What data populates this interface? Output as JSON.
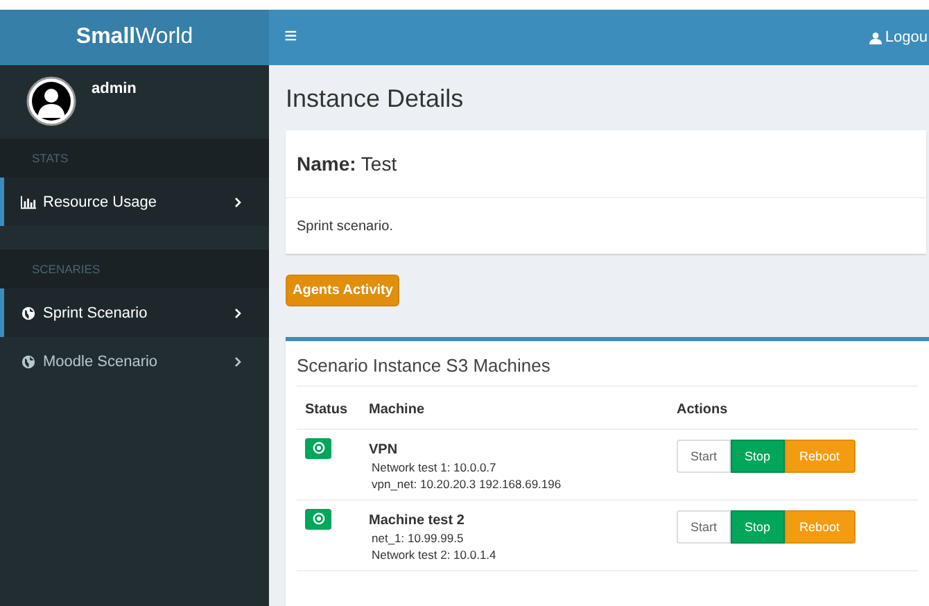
{
  "logo": "**Small**World",
  "navbar": {
    "menu_glyph": "≡",
    "logout": "Logou"
  },
  "user": {
    "name": "admin"
  },
  "sidebar": [
    {
      "header": "STATS",
      "items": [
        {
          "label": "Resource Usage",
          "kind": "chart",
          "selected": true
        }
      ]
    },
    {
      "header": "SCENARIES",
      "items": [
        {
          "label": "Sprint Scenario",
          "kind": "globe",
          "selected": true
        },
        {
          "label": "Moodle Scenario",
          "kind": "globe",
          "selected": false
        }
      ]
    }
  ],
  "page_title": "Instance Details",
  "instance": {
    "name": "**Name:** Test",
    "description": "Sprint scenario."
  },
  "agents_button": "Agents Activity",
  "machines": {
    "title": "Scenario Instance S3 Machines",
    "columns": [
      "Status",
      "Machine",
      "Actions"
    ],
    "rows": [
      {
        "on": true,
        "name": "VPN",
        "networks": [
          "Network test 1: 10.0.0.7",
          "vpn_net: 10.20.20.3  192.168.69.196"
        ],
        "actions": [
          "Start",
          "Stop",
          "Reboot"
        ]
      },
      {
        "on": true,
        "name": "Machine test 2",
        "networks": [
          "net_1: 10.99.99.5",
          "Network test 2: 10.0.1.4"
        ],
        "actions": [
          "Start",
          "Stop",
          "Reboot"
        ]
      }
    ]
  }
}
